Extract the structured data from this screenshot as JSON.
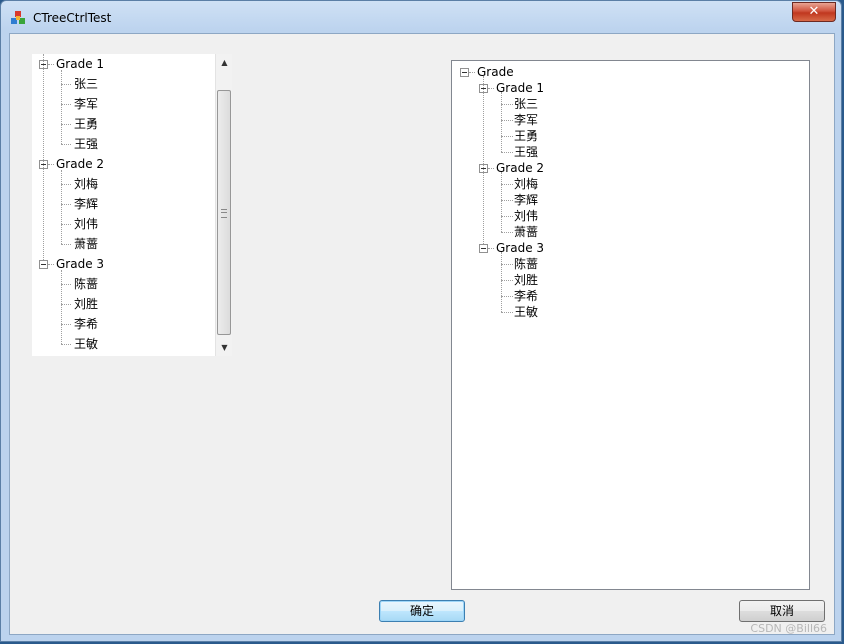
{
  "window": {
    "title": "CTreeCtrlTest",
    "close_label": "✕"
  },
  "left_tree": {
    "groups": [
      {
        "label": "Grade 1",
        "children": [
          "张三",
          "李军",
          "王勇",
          "王强"
        ]
      },
      {
        "label": "Grade 2",
        "children": [
          "刘梅",
          "李辉",
          "刘伟",
          "萧蔷"
        ]
      },
      {
        "label": "Grade 3",
        "children": [
          "陈蔷",
          "刘胜",
          "李希",
          "王敏"
        ]
      }
    ]
  },
  "right_tree": {
    "root": "Grade",
    "groups": [
      {
        "label": "Grade 1",
        "children": [
          "张三",
          "李军",
          "王勇",
          "王强"
        ]
      },
      {
        "label": "Grade 2",
        "children": [
          "刘梅",
          "李辉",
          "刘伟",
          "萧蔷"
        ]
      },
      {
        "label": "Grade 3",
        "children": [
          "陈蔷",
          "刘胜",
          "李希",
          "王敏"
        ]
      }
    ]
  },
  "buttons": {
    "ok_label": "确定",
    "cancel_label": "取消"
  },
  "watermark": "CSDN @Bill66",
  "icons": {
    "app": "app-icon",
    "close": "close-icon"
  }
}
